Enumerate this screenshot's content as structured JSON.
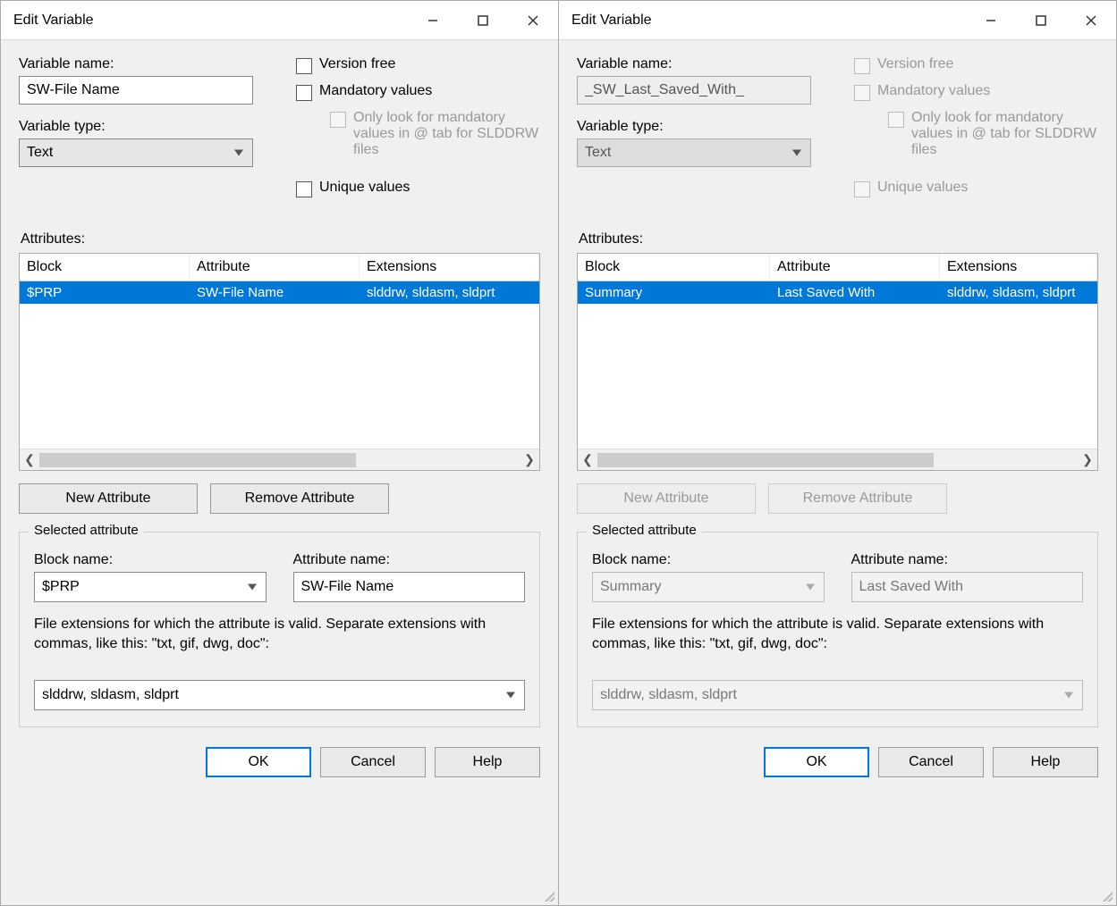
{
  "left": {
    "title": "Edit Variable",
    "var_name_label": "Variable name:",
    "var_name_value": "SW-File Name",
    "var_type_label": "Variable type:",
    "var_type_value": "Text",
    "chk_version_free": "Version free",
    "chk_mandatory": "Mandatory values",
    "chk_mandatory_sub": "Only look for mandatory values in @ tab for SLDDRW files",
    "chk_unique": "Unique values",
    "attrs_label": "Attributes:",
    "cols": {
      "c1": "Block",
      "c2": "Attribute",
      "c3": "Extensions"
    },
    "row": {
      "block": "$PRP",
      "attr": "SW-File Name",
      "ext": "slddrw, sldasm, sldprt"
    },
    "new_attr": "New Attribute",
    "remove_attr": "Remove Attribute",
    "sel_attr_title": "Selected attribute",
    "block_name_label": "Block name:",
    "block_name_value": "$PRP",
    "attr_name_label": "Attribute name:",
    "attr_name_value": "SW-File Name",
    "ext_help": "File extensions for which the attribute is valid. Separate extensions with commas, like this: \"txt, gif, dwg, doc\":",
    "ext_value": "slddrw, sldasm, sldprt",
    "ok": "OK",
    "cancel": "Cancel",
    "help": "Help"
  },
  "right": {
    "title": "Edit Variable",
    "var_name_label": "Variable name:",
    "var_name_value": "_SW_Last_Saved_With_",
    "var_type_label": "Variable type:",
    "var_type_value": "Text",
    "chk_version_free": "Version free",
    "chk_mandatory": "Mandatory values",
    "chk_mandatory_sub": "Only look for mandatory values in @ tab for SLDDRW files",
    "chk_unique": "Unique values",
    "attrs_label": "Attributes:",
    "cols": {
      "c1": "Block",
      "c2": "Attribute",
      "c3": "Extensions"
    },
    "row": {
      "block": "Summary",
      "attr": "Last Saved With",
      "ext": "slddrw, sldasm, sldprt"
    },
    "new_attr": "New Attribute",
    "remove_attr": "Remove Attribute",
    "sel_attr_title": "Selected attribute",
    "block_name_label": "Block name:",
    "block_name_value": "Summary",
    "attr_name_label": "Attribute name:",
    "attr_name_value": "Last Saved With",
    "ext_help": "File extensions for which the attribute is valid. Separate extensions with commas, like this: \"txt, gif, dwg, doc\":",
    "ext_value": "slddrw, sldasm, sldprt",
    "ok": "OK",
    "cancel": "Cancel",
    "help": "Help"
  }
}
